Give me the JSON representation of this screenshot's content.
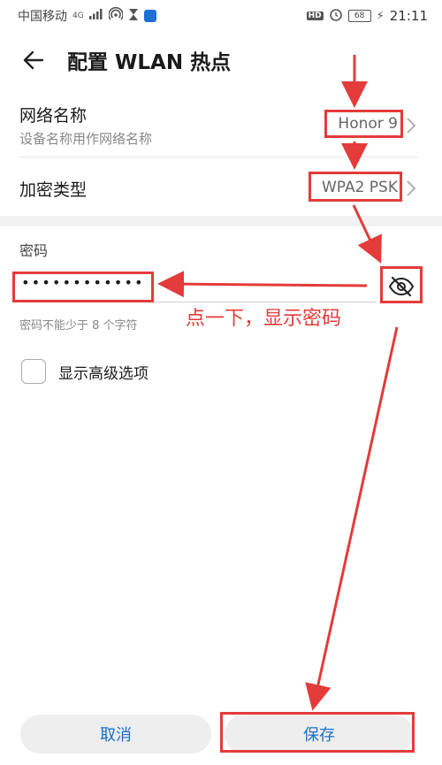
{
  "status_bar": {
    "carrier": "中国移动",
    "network": "4G",
    "time": "21:11",
    "battery": "68",
    "hd": "HD"
  },
  "header": {
    "title": "配置 WLAN 热点"
  },
  "ssid_row": {
    "label": "网络名称",
    "sublabel": "设备名称用作网络名称",
    "value": "Honor 9"
  },
  "encryption_row": {
    "label": "加密类型",
    "value": "WPA2 PSK"
  },
  "password": {
    "label": "密码",
    "masked_value": "••••••••••••",
    "hint": "密码不能少于 8 个字符"
  },
  "advanced": {
    "label": "显示高级选项",
    "checked": false
  },
  "buttons": {
    "cancel": "取消",
    "save": "保存"
  },
  "annotation": {
    "text": "点一下，显示密码",
    "color": "#e43b3b"
  },
  "colors": {
    "accent": "#1a6ec9",
    "annotation": "#e43b3b"
  },
  "icons": {
    "back": "arrow-left-icon",
    "chevron": "chevron-right-icon",
    "eye": "eye-off-icon"
  }
}
